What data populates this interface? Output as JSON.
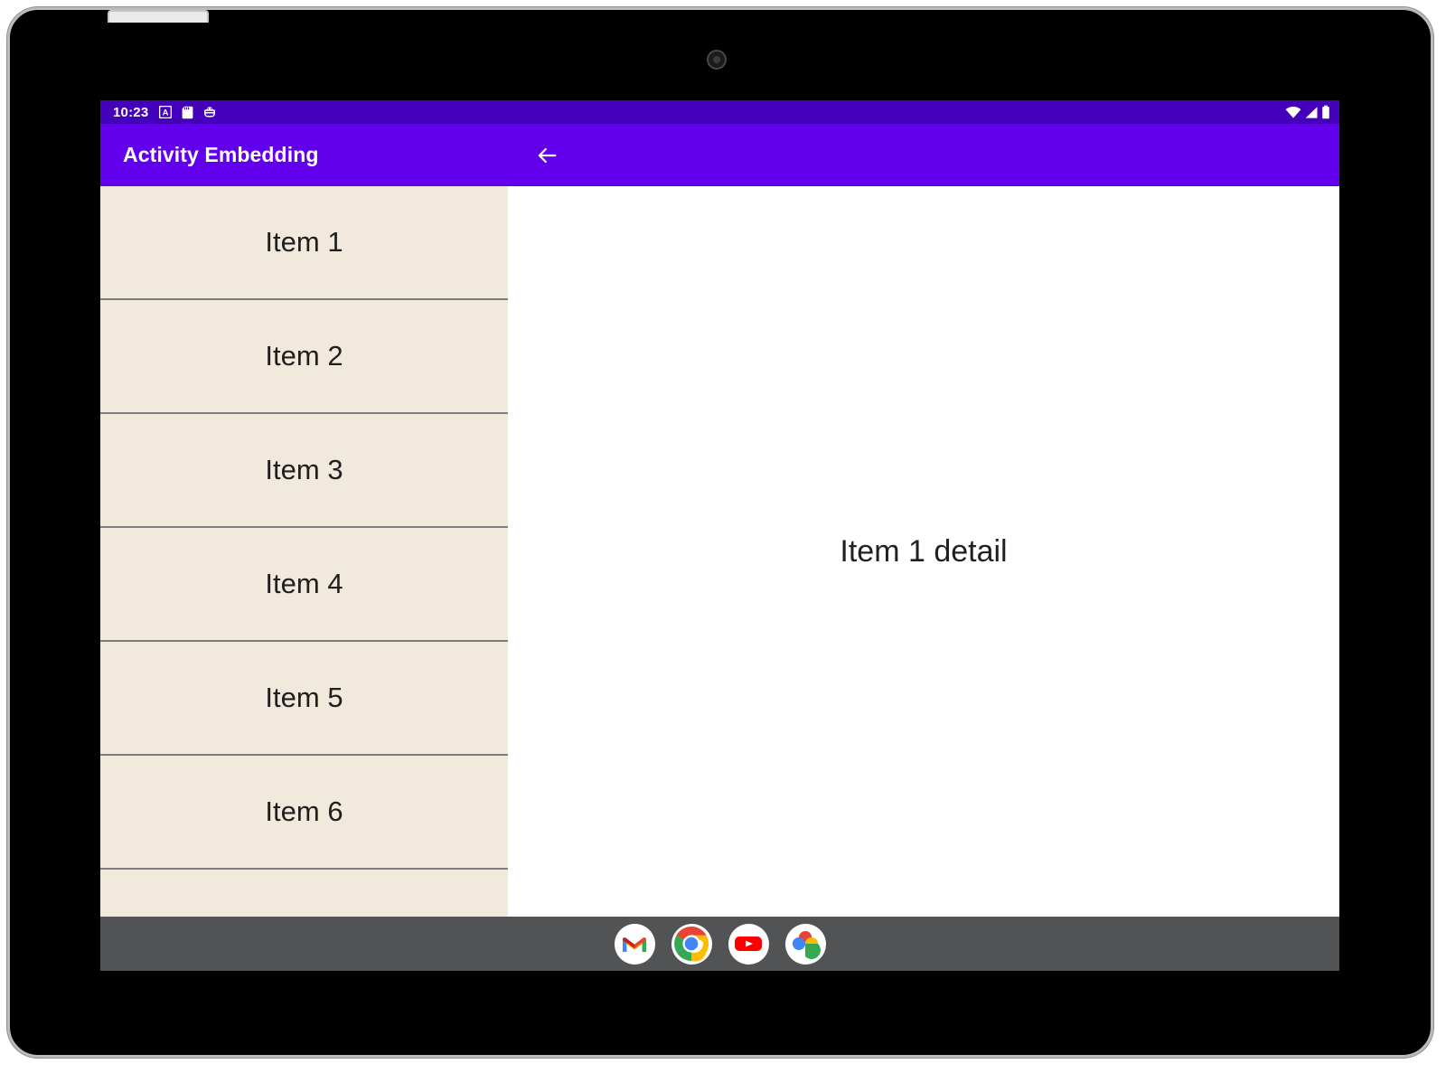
{
  "device": {
    "camera_icon": "front-camera"
  },
  "status_bar": {
    "clock": "10:23",
    "notification_icons": [
      "letter-a-badge-icon",
      "sd-card-icon",
      "android-debug-icon"
    ],
    "system_icons": [
      "wifi-icon",
      "cellular-signal-icon",
      "battery-icon"
    ],
    "background": "#4400bb"
  },
  "app_bar": {
    "title": "Activity Embedding",
    "back_label": "Back",
    "background": "#6200ee",
    "text_color": "#ffffff"
  },
  "list_pane": {
    "background": "#f0e9dc",
    "items": [
      {
        "label": "Item 1"
      },
      {
        "label": "Item 2"
      },
      {
        "label": "Item 3"
      },
      {
        "label": "Item 4"
      },
      {
        "label": "Item 5"
      },
      {
        "label": "Item 6"
      },
      {
        "label": ""
      }
    ]
  },
  "detail_pane": {
    "text": "Item 1 detail",
    "background": "#ffffff"
  },
  "taskbar": {
    "background": "#525355",
    "apps": [
      {
        "name": "Gmail",
        "icon": "gmail-icon"
      },
      {
        "name": "Chrome",
        "icon": "chrome-icon"
      },
      {
        "name": "YouTube",
        "icon": "youtube-icon"
      },
      {
        "name": "Google Photos",
        "icon": "google-photos-icon"
      }
    ]
  }
}
